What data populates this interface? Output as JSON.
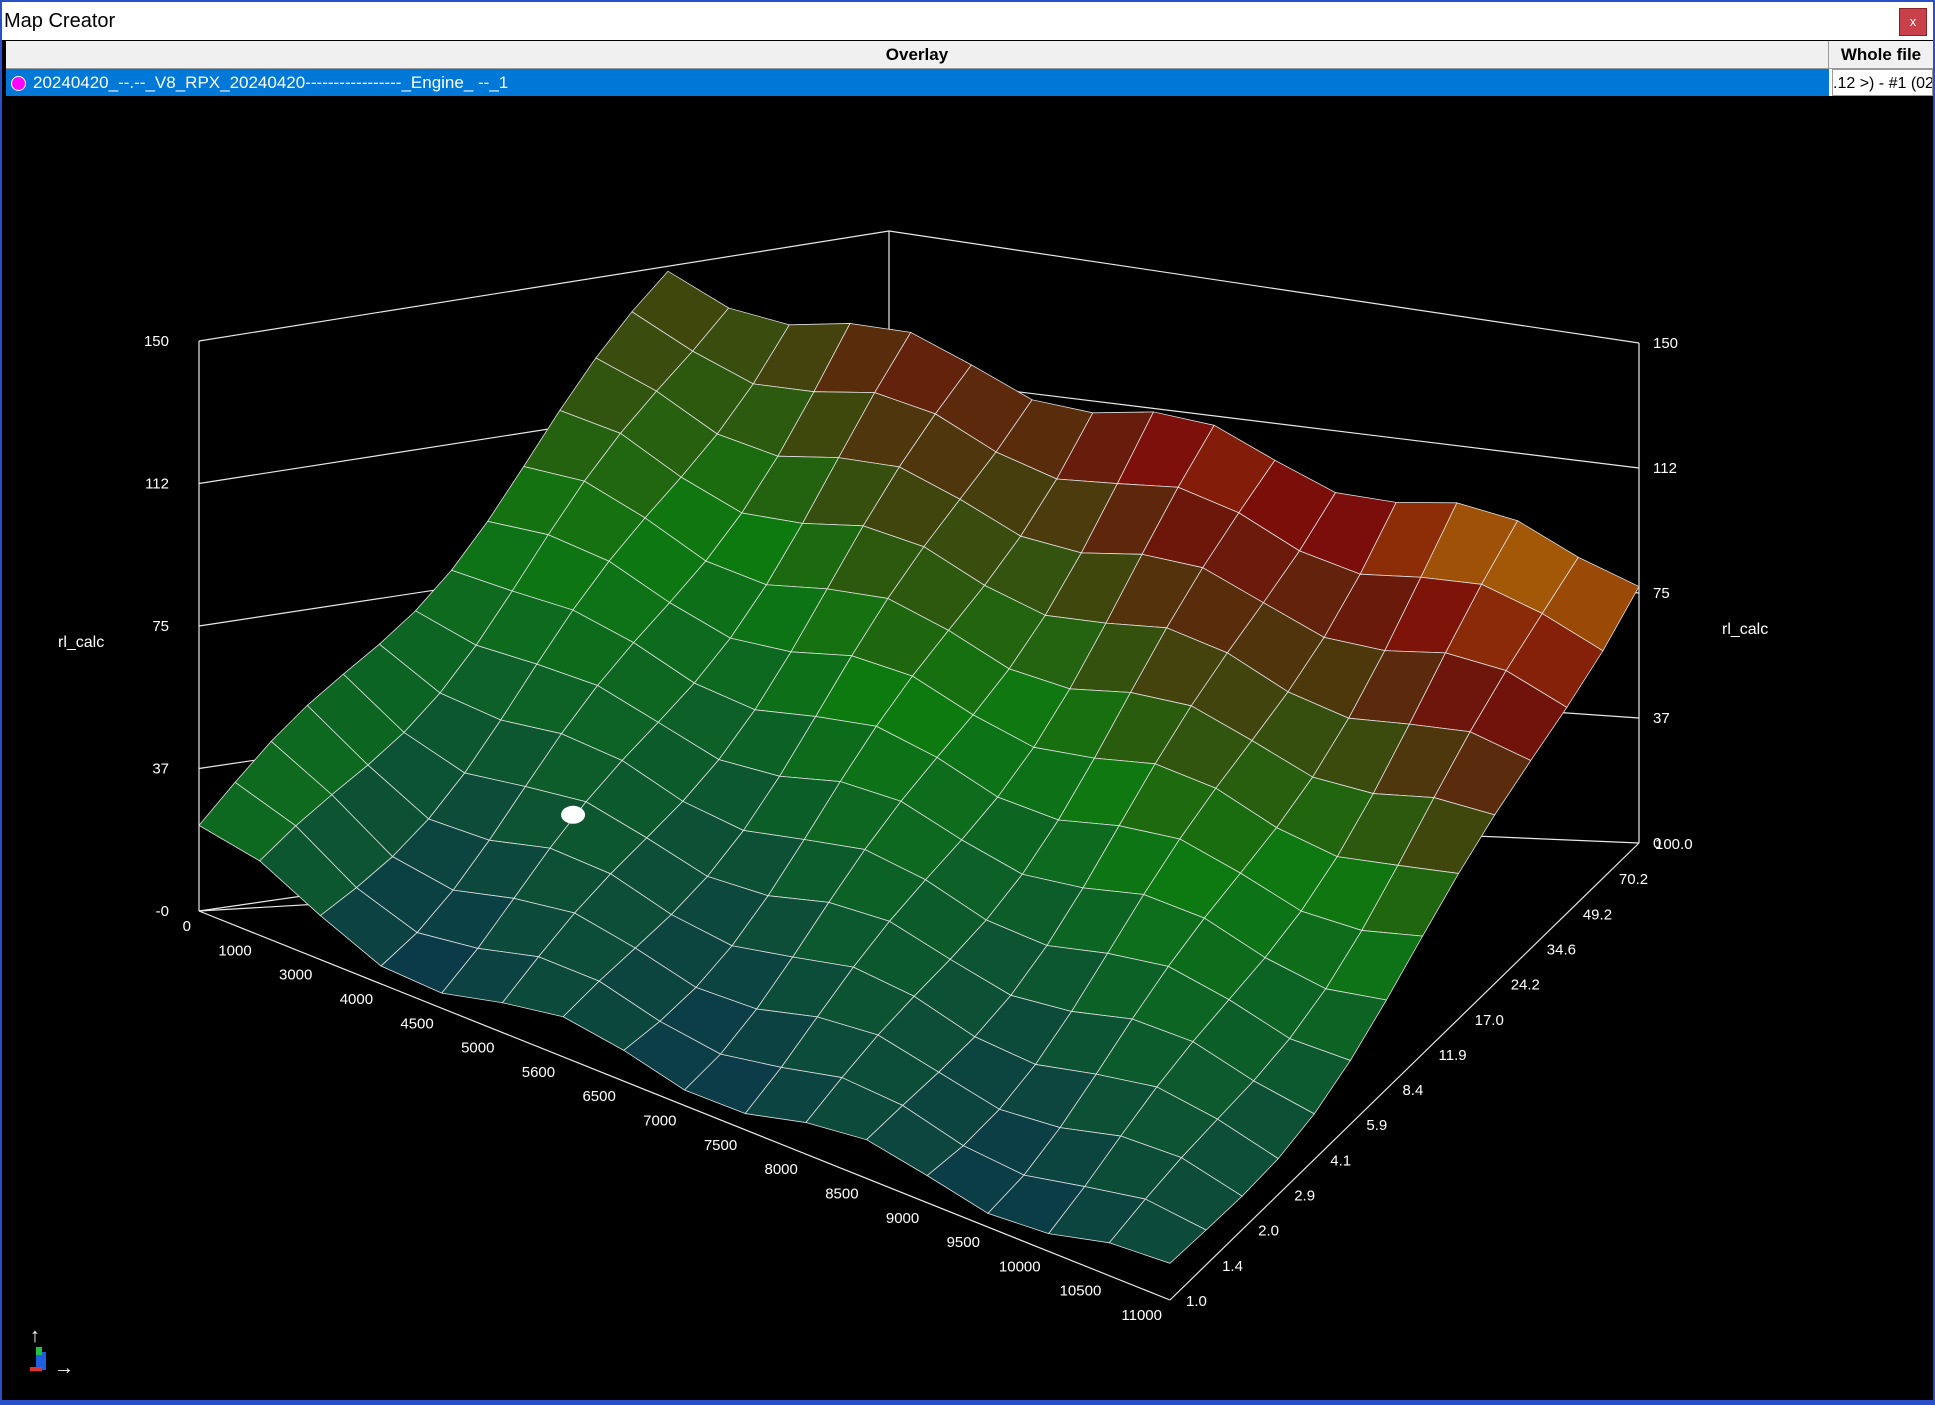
{
  "window": {
    "title": "Map Creator",
    "close_label": "x"
  },
  "table": {
    "headers": {
      "overlay": "Overlay",
      "whole_file": "Whole file"
    },
    "row": {
      "dot_color": "#ff00ff",
      "label": "20240420_--.--_V8_RPX_20240420-----------------_Engine_ --_1",
      "whole_file": ".12 >) - #1 (02"
    }
  },
  "chart_data": {
    "type": "surface",
    "z_label": "rl_calc",
    "z_ticks": [
      "-0",
      "37",
      "75",
      "112",
      "150"
    ],
    "z_ticks_right": [
      "0",
      "37",
      "75",
      "112",
      "150"
    ],
    "zlim": [
      0,
      150
    ],
    "x_ticks": [
      "0",
      "1000",
      "3000",
      "4000",
      "4500",
      "5000",
      "5600",
      "6500",
      "7000",
      "7500",
      "8000",
      "8500",
      "9000",
      "9500",
      "10000",
      "10500",
      "11000"
    ],
    "y_ticks": [
      "1.0",
      "1.4",
      "2.0",
      "2.9",
      "4.1",
      "5.9",
      "8.4",
      "11.9",
      "17.0",
      "24.2",
      "34.6",
      "49.2",
      "70.2",
      "100.0"
    ],
    "colormap": [
      "#0b2d55",
      "#0d7a10",
      "#7a0a0a",
      "#f0f000"
    ],
    "grid": true
  },
  "axes_icon": {
    "up": "↑",
    "right": "→"
  }
}
